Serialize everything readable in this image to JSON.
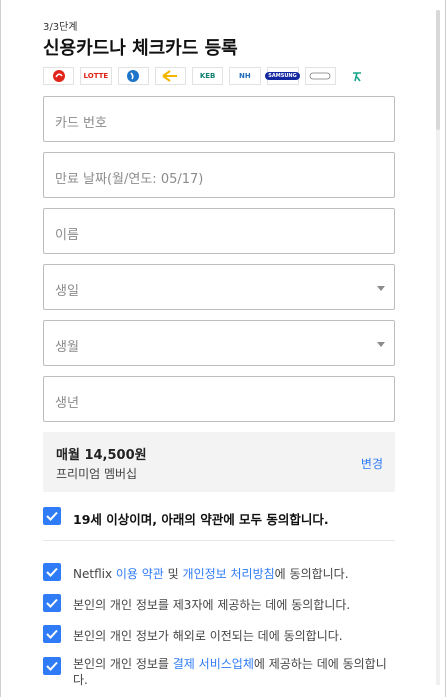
{
  "header": {
    "step": "3/3단계",
    "title": "신용카드나 체크카드 등록"
  },
  "card_logos": [
    {
      "name": "lotte-symbol",
      "text": "",
      "color": "#e1251b"
    },
    {
      "name": "lotte",
      "text": "LOTTE",
      "color": "#e1251b"
    },
    {
      "name": "woori",
      "text": "",
      "color": "#1e74c9"
    },
    {
      "name": "kb",
      "text": "",
      "color": "#f2b600"
    },
    {
      "name": "keb",
      "text": "KEB",
      "color": "#0d7e6e"
    },
    {
      "name": "nh",
      "text": "NH",
      "color": "#1e6bb8"
    },
    {
      "name": "samsung",
      "text": "SAMSUNG",
      "color": "#1428a0"
    },
    {
      "name": "hyundai",
      "text": "",
      "color": "#555555"
    },
    {
      "name": "shinhan",
      "text": "",
      "color": "#17a589"
    }
  ],
  "form": {
    "card_number": {
      "placeholder": "카드 번호",
      "value": ""
    },
    "expiry": {
      "placeholder": "만료 날짜(월/연도: 05/17)",
      "value": ""
    },
    "name": {
      "placeholder": "이름",
      "value": ""
    },
    "birth_day": {
      "placeholder": "생일",
      "value": ""
    },
    "birth_month": {
      "placeholder": "생월",
      "value": ""
    },
    "birth_year": {
      "placeholder": "생년",
      "value": ""
    }
  },
  "plan": {
    "price": "매월 14,500원",
    "name": "프리미엄 멤버십",
    "change_label": "변경"
  },
  "agreements": {
    "all": "19세 이상이며, 아래의 약관에 모두 동의합니다.",
    "netflix_prefix": "Netflix ",
    "terms_link": "이용 약관",
    "and": " 및 ",
    "privacy_link": "개인정보 처리방침",
    "netflix_suffix": "에 동의합니다.",
    "third_party": "본인의 개인 정보를 제3자에 제공하는 데에 동의합니다.",
    "overseas": "본인의 개인 정보가 해외로 이전되는 데에 동의합니다.",
    "payment_prefix": "본인의 개인 정보를 ",
    "payment_link": "결제 서비스업체",
    "payment_suffix": "에 제공하는 데에 동의합니다."
  },
  "colors": {
    "accent": "#2f7cf6"
  }
}
